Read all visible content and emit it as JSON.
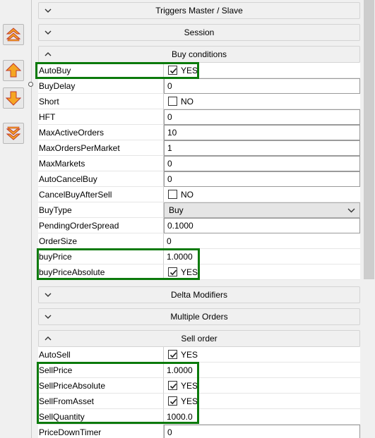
{
  "toolbar": {
    "buttons": [
      {
        "name": "move-to-top",
        "icon": "double-up-arrow-icon"
      },
      {
        "name": "move-up",
        "icon": "up-arrow-icon"
      },
      {
        "name": "move-down",
        "icon": "down-arrow-icon"
      },
      {
        "name": "move-to-bottom",
        "icon": "double-down-arrow-icon"
      }
    ],
    "accent_color": "#f5a623"
  },
  "sections": {
    "triggers": {
      "title": "Triggers  Master / Slave",
      "expanded": false
    },
    "session": {
      "title": "Session",
      "expanded": false
    },
    "buy_conditions": {
      "title": "Buy conditions",
      "expanded": true
    },
    "delta_modifiers": {
      "title": "Delta Modifiers",
      "expanded": false
    },
    "multiple_orders": {
      "title": "Multiple Orders",
      "expanded": false
    },
    "sell_order": {
      "title": "Sell order",
      "expanded": true
    }
  },
  "buy": {
    "autobuy": {
      "name": "AutoBuy",
      "value": "YES",
      "checked": true
    },
    "buydelay": {
      "name": "BuyDelay",
      "value": "0"
    },
    "short": {
      "name": "Short",
      "value": "NO",
      "checked": false
    },
    "hft": {
      "name": "HFT",
      "value": "0"
    },
    "maxactiveorders": {
      "name": "MaxActiveOrders",
      "value": "10"
    },
    "maxorderspermarket": {
      "name": "MaxOrdersPerMarket",
      "value": "1"
    },
    "maxmarkets": {
      "name": "MaxMarkets",
      "value": "0"
    },
    "autocancelbuy": {
      "name": "AutoCancelBuy",
      "value": "0"
    },
    "cancelbuyaftersell": {
      "name": "CancelBuyAfterSell",
      "value": "NO",
      "checked": false
    },
    "buytype": {
      "name": "BuyType",
      "value": "Buy"
    },
    "pendingorderspread": {
      "name": "PendingOrderSpread",
      "value": "0.1000"
    },
    "ordersize": {
      "name": "OrderSize",
      "value": "0"
    },
    "buyprice": {
      "name": "buyPrice",
      "value": "1.0000"
    },
    "buypriceabsolute": {
      "name": "buyPriceAbsolute",
      "value": "YES",
      "checked": true
    }
  },
  "sell": {
    "autosell": {
      "name": "AutoSell",
      "value": "YES",
      "checked": true
    },
    "sellprice": {
      "name": "SellPrice",
      "value": "1.0000"
    },
    "sellpriceabsolute": {
      "name": "SellPriceAbsolute",
      "value": "YES",
      "checked": true
    },
    "sellfromasset": {
      "name": "SellFromAsset",
      "value": "YES",
      "checked": true
    },
    "sellquantity": {
      "name": "SellQuantity",
      "value": "1000.0"
    },
    "pricedowntimer": {
      "name": "PriceDownTimer",
      "value": "0"
    }
  },
  "highlight_color": "#0b7a0b"
}
